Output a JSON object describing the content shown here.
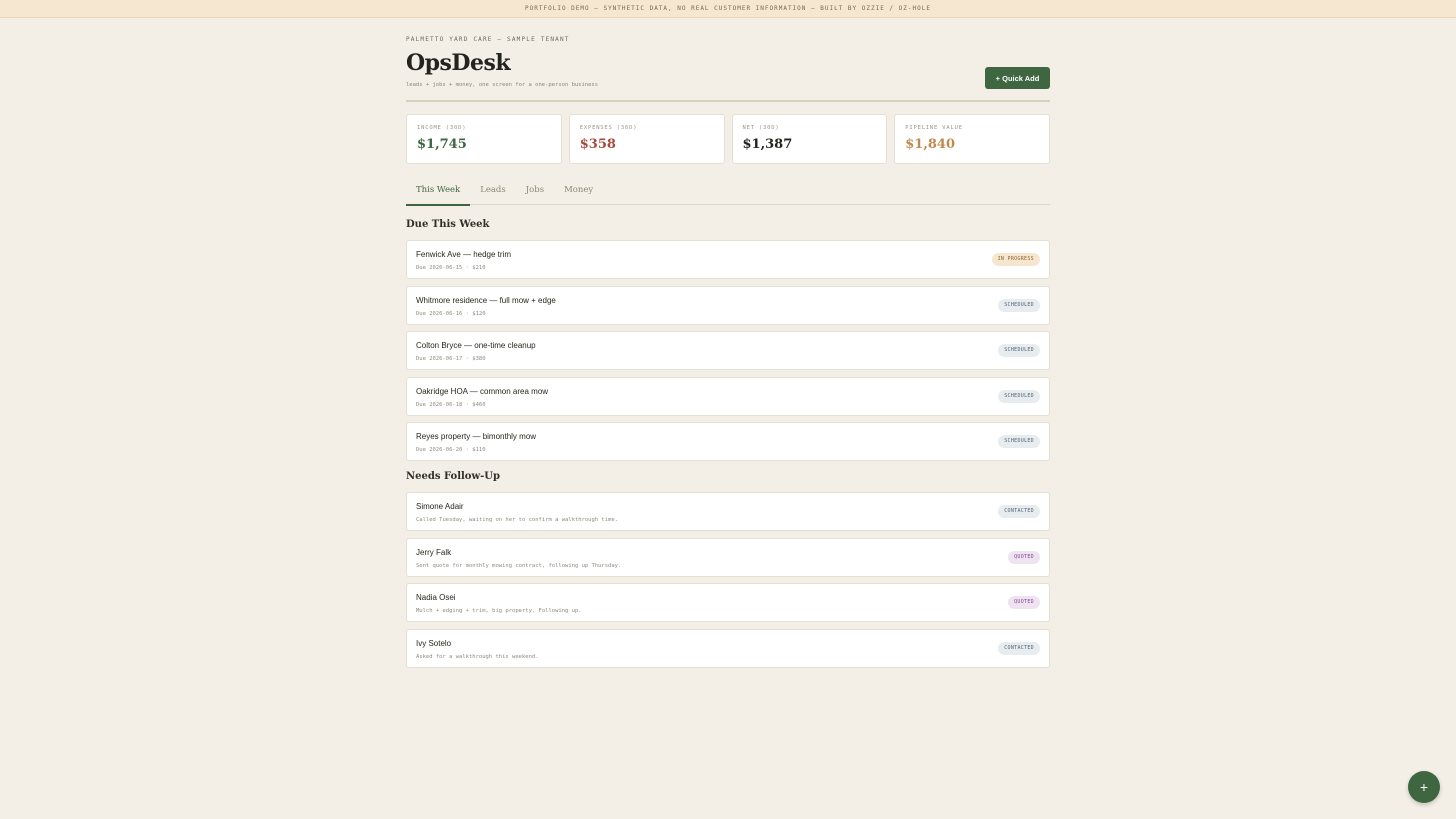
{
  "banner": "PORTFOLIO DEMO — SYNTHETIC DATA, NO REAL CUSTOMER INFORMATION — BUILT BY OZZIE / OZ-HOLE",
  "tenant": "PALMETTO YARD CARE — SAMPLE TENANT",
  "app": {
    "title": "OpsDesk",
    "tagline": "leads + jobs + money, one screen for a one-person business",
    "quick_add": "+ Quick Add"
  },
  "stats": [
    {
      "label": "INCOME (30D)",
      "value": "$1,745",
      "color": "#3e6640"
    },
    {
      "label": "EXPENSES (30D)",
      "value": "$358",
      "color": "#a54a3c"
    },
    {
      "label": "NET (30D)",
      "value": "$1,387",
      "color": "#23241e"
    },
    {
      "label": "PIPELINE VALUE",
      "value": "$1,840",
      "color": "#c08a4f"
    }
  ],
  "tabs": [
    {
      "label": "This Week",
      "active": true
    },
    {
      "label": "Leads",
      "active": false
    },
    {
      "label": "Jobs",
      "active": false
    },
    {
      "label": "Money",
      "active": false
    }
  ],
  "due_section": {
    "title": "Due This Week",
    "items": [
      {
        "title": "Fenwick Ave — hedge trim",
        "sub": "Due 2026-06-15 · $210",
        "status": "IN PROGRESS"
      },
      {
        "title": "Whitmore residence — full mow + edge",
        "sub": "Due 2026-06-16 · $120",
        "status": "SCHEDULED"
      },
      {
        "title": "Colton Bryce — one-time cleanup",
        "sub": "Due 2026-06-17 · $380",
        "status": "SCHEDULED"
      },
      {
        "title": "Oakridge HOA — common area mow",
        "sub": "Due 2026-06-18 · $460",
        "status": "SCHEDULED"
      },
      {
        "title": "Reyes property — bimonthly mow",
        "sub": "Due 2026-06-20 · $110",
        "status": "SCHEDULED"
      }
    ]
  },
  "followup_section": {
    "title": "Needs Follow-Up",
    "items": [
      {
        "title": "Simone Adair",
        "sub": "Called Tuesday, waiting on her to confirm a walkthrough time.",
        "status": "CONTACTED"
      },
      {
        "title": "Jerry Falk",
        "sub": "Sent quote for monthly mowing contract, following up Thursday.",
        "status": "QUOTED"
      },
      {
        "title": "Nadia Osei",
        "sub": "Mulch + edging + trim, big property. Following up.",
        "status": "QUOTED"
      },
      {
        "title": "Ivy Sotelo",
        "sub": "Asked for a walkthrough this weekend.",
        "status": "CONTACTED"
      }
    ]
  },
  "fab_label": "+"
}
